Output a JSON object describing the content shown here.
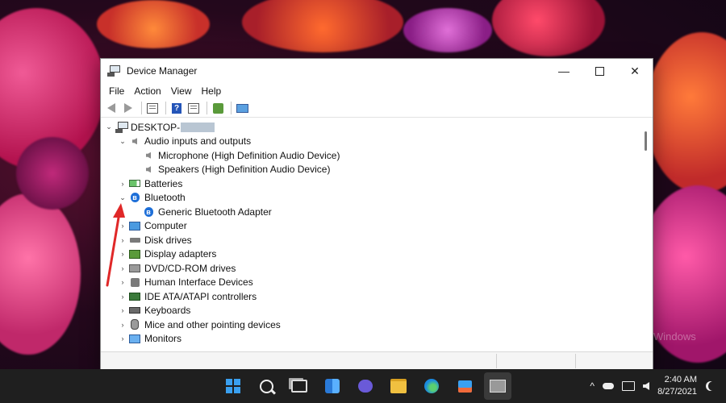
{
  "window": {
    "title": "Device Manager",
    "controls": {
      "minimize": "—",
      "close": "✕"
    }
  },
  "menu": [
    "File",
    "Action",
    "View",
    "Help"
  ],
  "tree": {
    "root": "DESKTOP-",
    "items": [
      {
        "label": "Audio inputs and outputs",
        "expanded": true,
        "icon": "speaker-icon",
        "children": [
          {
            "label": "Microphone (High Definition Audio Device)",
            "icon": "speaker-icon"
          },
          {
            "label": "Speakers (High Definition Audio Device)",
            "icon": "speaker-icon"
          }
        ]
      },
      {
        "label": "Batteries",
        "expanded": false,
        "icon": "battery-icon"
      },
      {
        "label": "Bluetooth",
        "expanded": true,
        "icon": "bluetooth-icon",
        "children": [
          {
            "label": "Generic Bluetooth Adapter",
            "icon": "bluetooth-icon"
          }
        ]
      },
      {
        "label": "Computer",
        "expanded": false,
        "icon": "computer-icon"
      },
      {
        "label": "Disk drives",
        "expanded": false,
        "icon": "disk-icon"
      },
      {
        "label": "Display adapters",
        "expanded": false,
        "icon": "display-adapter-icon"
      },
      {
        "label": "DVD/CD-ROM drives",
        "expanded": false,
        "icon": "dvd-icon"
      },
      {
        "label": "Human Interface Devices",
        "expanded": false,
        "icon": "hid-icon"
      },
      {
        "label": "IDE ATA/ATAPI controllers",
        "expanded": false,
        "icon": "ide-icon"
      },
      {
        "label": "Keyboards",
        "expanded": false,
        "icon": "keyboard-icon"
      },
      {
        "label": "Mice and other pointing devices",
        "expanded": false,
        "icon": "mouse-icon"
      },
      {
        "label": "Monitors",
        "expanded": false,
        "icon": "monitor-icon"
      }
    ]
  },
  "desktop": {
    "watermark": "Windows"
  },
  "taskbar": {
    "time": "2:40 AM",
    "date": "8/27/2021",
    "tray_chevron": "^"
  },
  "colors": {
    "annotation": "#e02828",
    "taskbar": "#1f1f1f",
    "bluetooth": "#1e6fd8"
  }
}
